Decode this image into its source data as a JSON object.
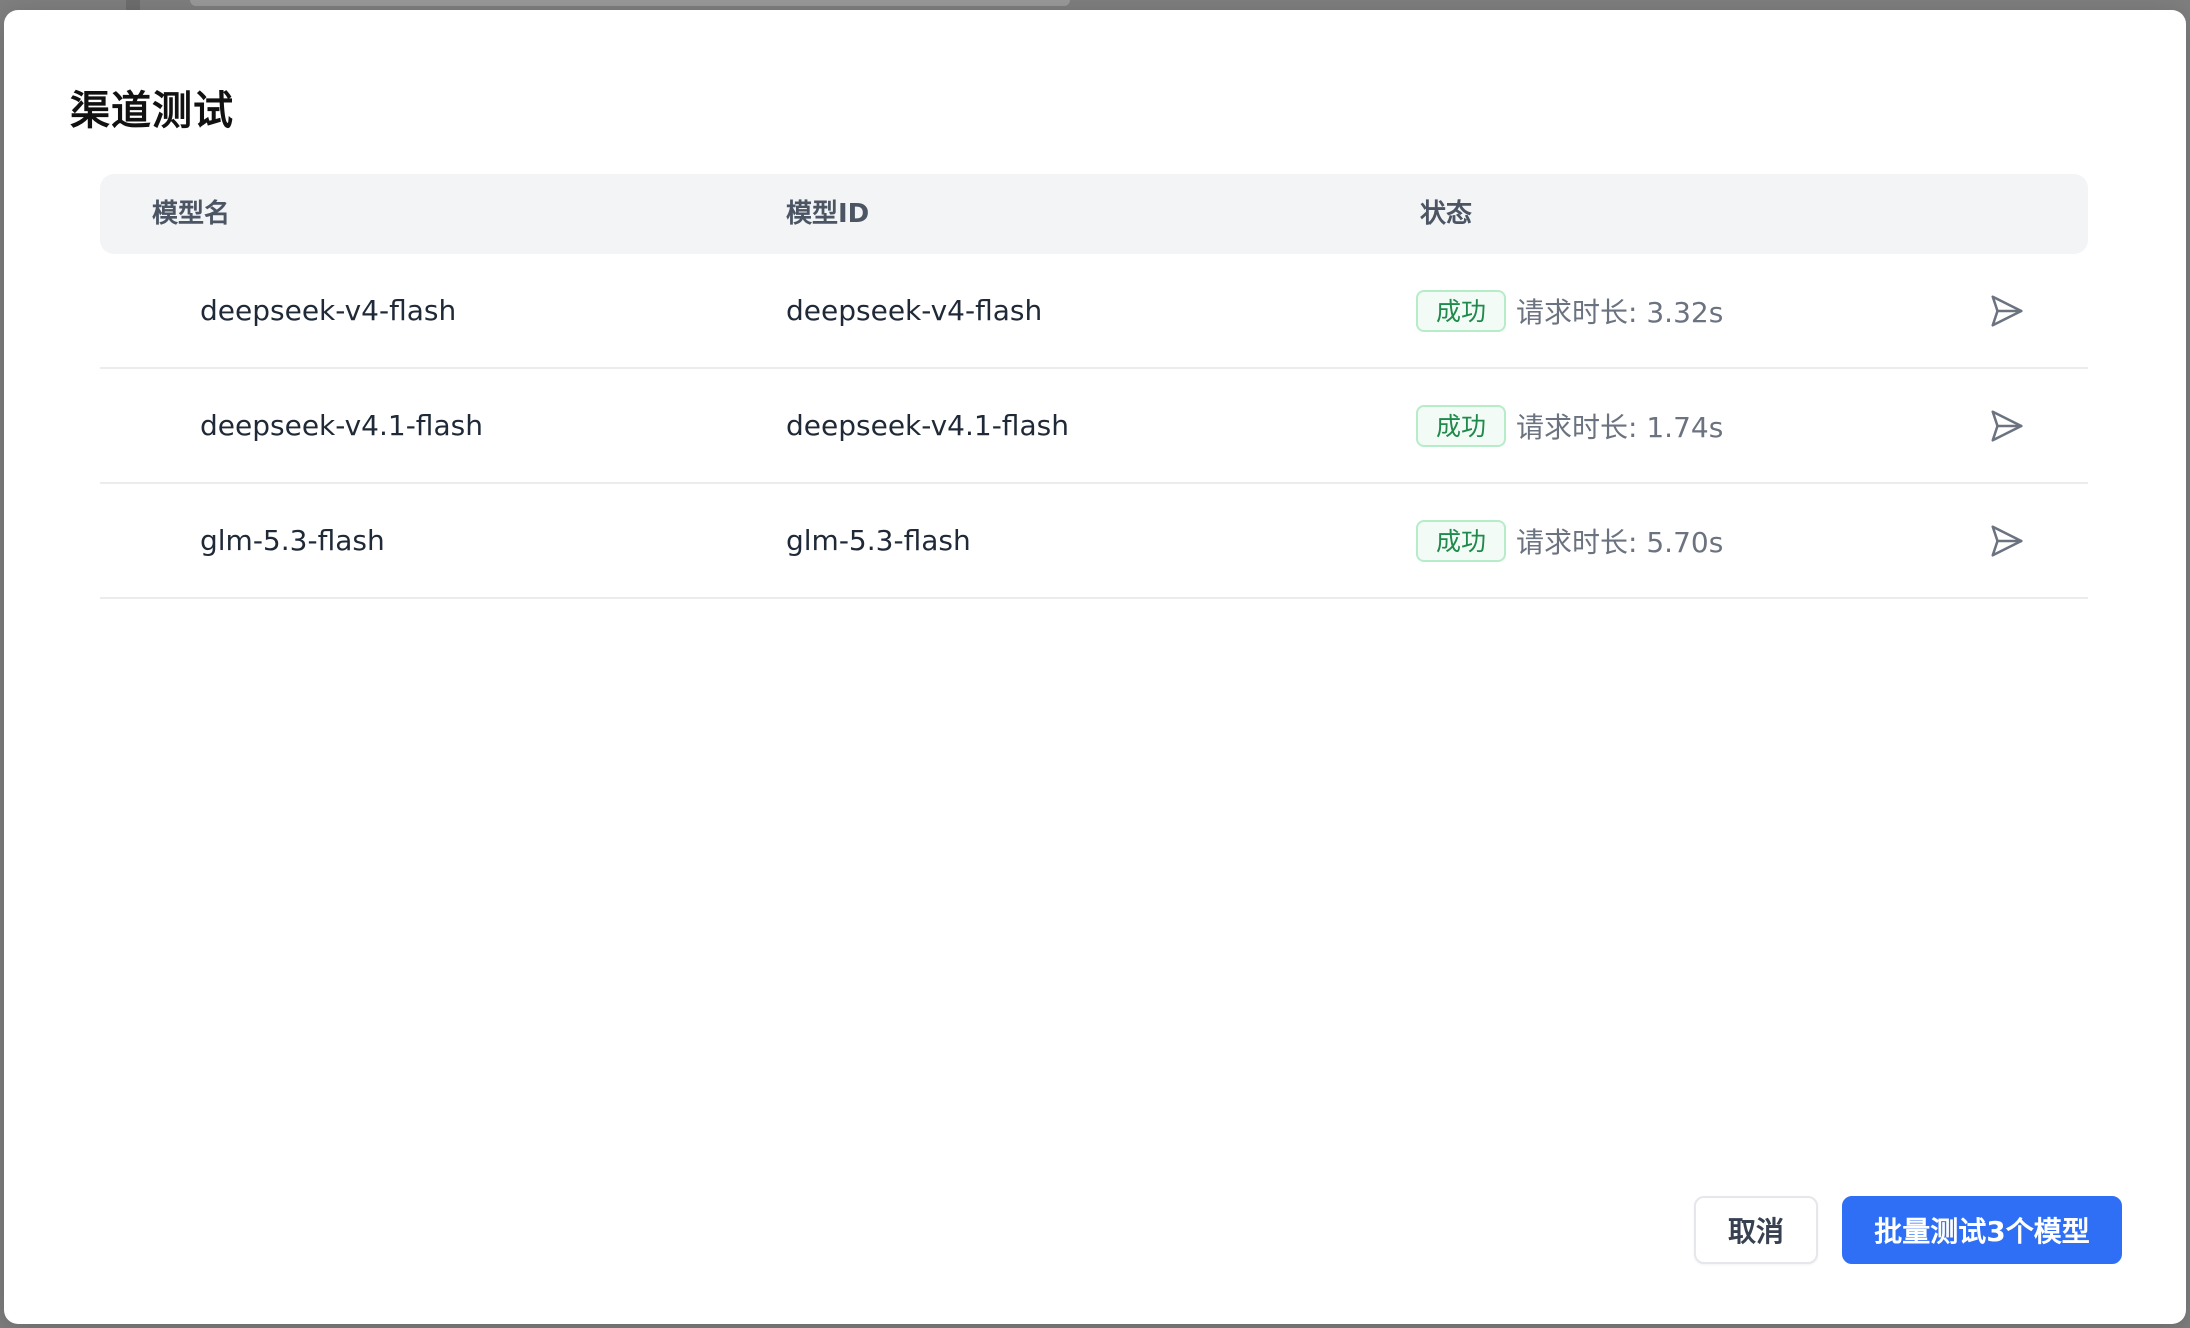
{
  "modal": {
    "title": "渠道测试"
  },
  "table": {
    "headers": {
      "name": "模型名",
      "id": "模型ID",
      "status": "状态"
    },
    "rows": [
      {
        "name": "deepseek-v4-flash",
        "id": "deepseek-v4-flash",
        "status": "成功",
        "duration": "请求时长: 3.32s"
      },
      {
        "name": "deepseek-v4.1-flash",
        "id": "deepseek-v4.1-flash",
        "status": "成功",
        "duration": "请求时长: 1.74s"
      },
      {
        "name": "glm-5.3-flash",
        "id": "glm-5.3-flash",
        "status": "成功",
        "duration": "请求时长: 5.70s"
      }
    ]
  },
  "footer": {
    "cancel_label": "取消",
    "batch_label": "批量测试3个模型"
  },
  "icons": {
    "row_action": "send-icon"
  },
  "colors": {
    "primary": "#2f6ff5",
    "success": "#1f8a4c"
  }
}
